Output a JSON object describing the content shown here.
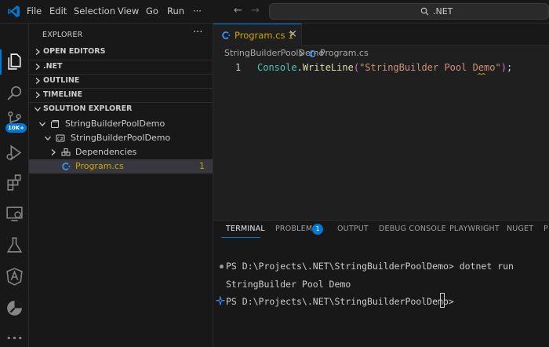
{
  "titlebar": {
    "menu": [
      "File",
      "Edit",
      "Selection",
      "View",
      "Go",
      "Run",
      "···"
    ],
    "search_text": ".NET"
  },
  "activitybar": {
    "source_control_badge": "10K+"
  },
  "sidebar": {
    "title": "EXPLORER",
    "more_label": "···",
    "sections": {
      "open_editors": "OPEN EDITORS",
      "dotnet": ".NET",
      "outline": "OUTLINE",
      "timeline": "TIMELINE",
      "solution_explorer": "SOLUTION EXPLORER"
    },
    "tree": {
      "solution": "StringBuilderPoolDemo",
      "project": "StringBuilderPoolDemo",
      "dependencies": "Dependencies",
      "file": "Program.cs",
      "file_problems": "1"
    }
  },
  "editor": {
    "tab_label": "Program.cs 1",
    "tab_close": "×",
    "breadcrumb_folder": "StringBuilderPoolDemo",
    "breadcrumb_file": "Program.cs",
    "line_number": "1",
    "code": {
      "class": "Console",
      "dot": ".",
      "method": "WriteLine",
      "open_paren": "(",
      "string": "\"StringBuilder Pool Demo\"",
      "close_paren": ")",
      "semicolon": ";"
    }
  },
  "panel": {
    "tabs": {
      "terminal": "TERMINAL",
      "problems": "PROBLEMS",
      "problems_count": "1",
      "output": "OUTPUT",
      "debug_console": "DEBUG CONSOLE",
      "playwright": "PLAYWRIGHT",
      "nuget": "NUGET",
      "overflow": "P"
    },
    "terminal_lines": [
      "PS D:\\Projects\\.NET\\StringBuilderPoolDemo> dotnet run",
      "StringBuilder Pool Demo",
      "PS D:\\Projects\\.NET\\StringBuilderPoolDemo> "
    ]
  },
  "colors": {
    "accent": "#0078d4",
    "warning": "#cca700",
    "background": "#1f1f1f",
    "chrome": "#181818"
  }
}
